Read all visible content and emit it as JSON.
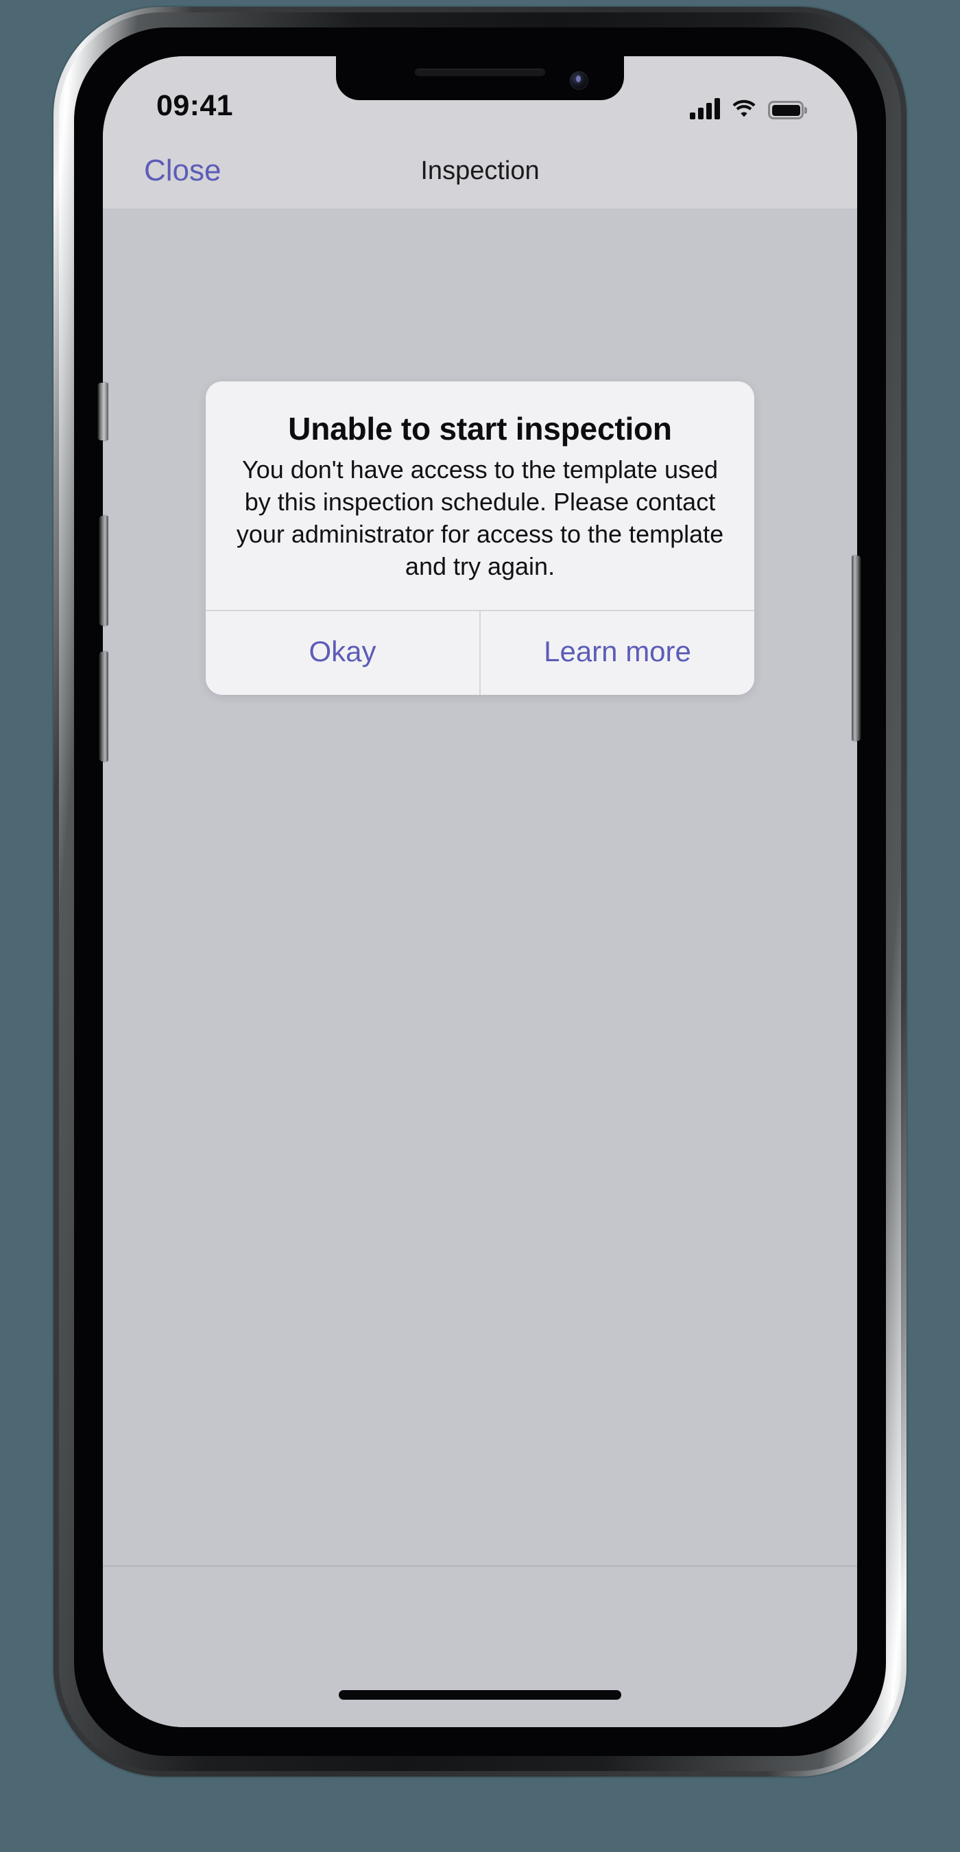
{
  "page": {
    "background_color": "#4d6873"
  },
  "device": {
    "name": "iphone-frame",
    "buttons": {
      "mute_switch": "mute-switch",
      "volume_up": "volume-up-button",
      "volume_down": "volume-down-button",
      "power": "power-button"
    },
    "notch": {
      "speaker": "earpiece-speaker",
      "camera": "front-camera"
    }
  },
  "status_bar": {
    "time": "09:41",
    "cellular_icon": "cellular-signal-icon",
    "cellular_bars_filled": 4,
    "cellular_bars_total": 4,
    "wifi_icon": "wifi-icon",
    "battery_icon": "battery-icon",
    "battery_level_percent": 100,
    "background_color": "#d4d3d7"
  },
  "nav_bar": {
    "close_label": "Close",
    "title": "Inspection",
    "accent_color": "#5c5cb8",
    "background_color": "#d4d3d7"
  },
  "content": {
    "background_color": "#c4c6cc"
  },
  "alert": {
    "title": "Unable to start inspection",
    "message": "You don't have access to the template used by this inspection schedule. Please contact your administrator for access to the template and try again.",
    "background_color": "#f2f2f4",
    "buttons": [
      {
        "label": "Okay",
        "color": "#5c5cb8"
      },
      {
        "label": "Learn more",
        "color": "#5c5cb8"
      }
    ],
    "primary_button_label": "Okay",
    "secondary_button_label": "Learn more"
  },
  "home_indicator": {
    "name": "home-indicator",
    "color": "#08080a"
  }
}
